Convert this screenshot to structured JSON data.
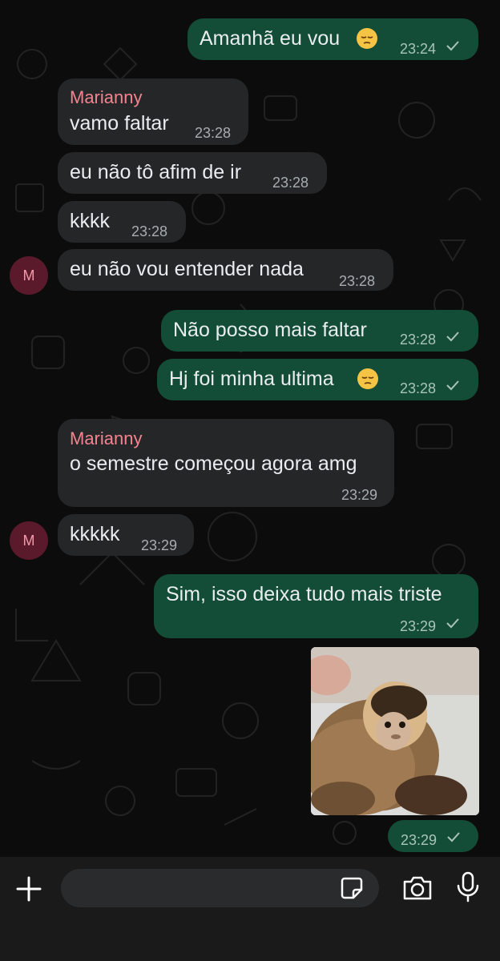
{
  "contact": {
    "name": "Marianny",
    "avatar_initial": "M"
  },
  "messages": [
    {
      "id": "m1",
      "direction": "out",
      "text": "Amanhã eu vou",
      "emoji": "pensive-face",
      "time": "23:24",
      "status": "sent"
    },
    {
      "id": "m2",
      "direction": "in",
      "sender": "Marianny",
      "text": "vamo faltar",
      "time": "23:28"
    },
    {
      "id": "m3",
      "direction": "in",
      "text": "eu não tô afim de ir",
      "time": "23:28"
    },
    {
      "id": "m4",
      "direction": "in",
      "text": "kkkk",
      "time": "23:28"
    },
    {
      "id": "m5",
      "direction": "in",
      "text": "eu não vou entender nada",
      "time": "23:28",
      "avatar": "M"
    },
    {
      "id": "m6",
      "direction": "out",
      "text": "Não posso mais faltar",
      "time": "23:28",
      "status": "sent"
    },
    {
      "id": "m7",
      "direction": "out",
      "text": "Hj foi minha ultima",
      "emoji": "pensive-face",
      "time": "23:28",
      "status": "sent"
    },
    {
      "id": "m8",
      "direction": "in",
      "sender": "Marianny",
      "text": "o semestre começou agora amg",
      "time": "23:29"
    },
    {
      "id": "m9",
      "direction": "in",
      "text": "kkkkk",
      "time": "23:29",
      "avatar": "M"
    },
    {
      "id": "m10",
      "direction": "out",
      "text": "Sim, isso deixa tudo mais triste",
      "time": "23:29",
      "status": "sent"
    },
    {
      "id": "m11",
      "direction": "out",
      "type": "image",
      "image": "capuchin-monkey-photo",
      "time": "23:29",
      "status": "sent"
    }
  ],
  "composer": {
    "placeholder": "",
    "icons": [
      "plus-icon",
      "sticker-icon",
      "camera-icon",
      "microphone-icon"
    ]
  },
  "colors": {
    "background": "#0c0c0c",
    "incoming_bubble": "#252627",
    "outgoing_bubble": "#144d37",
    "sender_name": "#f4838f",
    "avatar_bg": "#5a1a2c",
    "composer_bar": "#1a1a1a"
  }
}
